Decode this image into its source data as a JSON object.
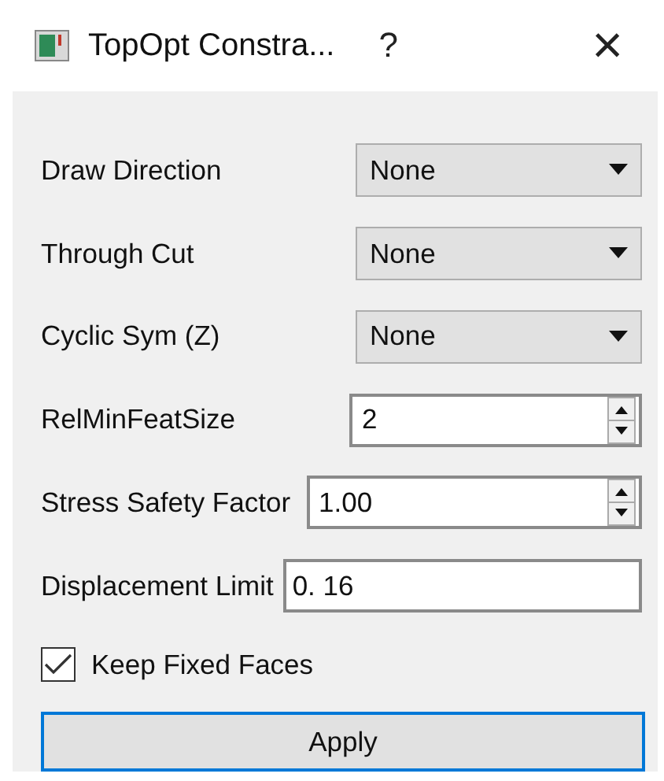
{
  "window": {
    "title": "TopOpt Constra...",
    "help": "?",
    "close": "×"
  },
  "fields": [
    {
      "kind": "combo",
      "label": "Draw Direction",
      "value": "None"
    },
    {
      "kind": "combo",
      "label": "Through Cut",
      "value": "None"
    },
    {
      "kind": "combo",
      "label": "Cyclic Sym (Z)",
      "value": "None"
    },
    {
      "kind": "spin",
      "label": "RelMinFeatSize",
      "value": "2"
    },
    {
      "kind": "spin",
      "label": "Stress Safety Factor",
      "value": "1.00"
    },
    {
      "kind": "text",
      "label": "Displacement Limit",
      "value": "0. 16"
    }
  ],
  "checkbox": {
    "label": "Keep Fixed Faces",
    "checked": true
  },
  "button": {
    "label": "Apply"
  }
}
